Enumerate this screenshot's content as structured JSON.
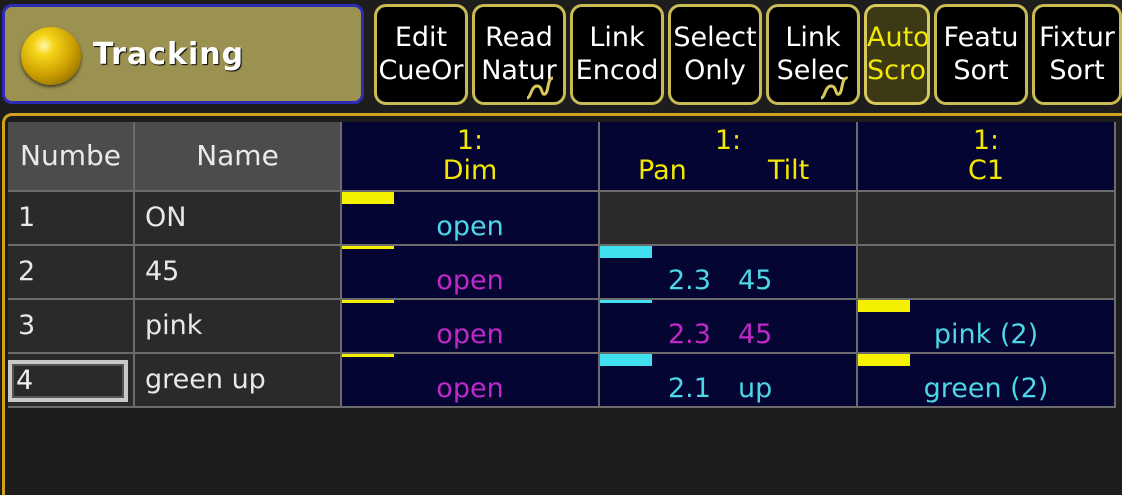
{
  "title": "Tracking",
  "toolbar": [
    {
      "l1": "Edit",
      "l2": "CueOr",
      "active": false,
      "curl": false
    },
    {
      "l1": "Read",
      "l2": "Natur",
      "active": false,
      "curl": true
    },
    {
      "l1": "Link",
      "l2": "Encod",
      "active": false,
      "curl": false
    },
    {
      "l1": "Select",
      "l2": "Only",
      "active": false,
      "curl": false
    },
    {
      "l1": "Link",
      "l2": "Selec",
      "active": false,
      "curl": true
    },
    {
      "l1": "Auto",
      "l2": "Scrol",
      "active": true,
      "curl": false
    },
    {
      "l1": "Featu",
      "l2": "Sort",
      "active": false,
      "curl": false
    },
    {
      "l1": "Fixtur",
      "l2": "Sort",
      "active": false,
      "curl": false
    }
  ],
  "table": {
    "headers": {
      "number": "Numbe",
      "name": "Name"
    },
    "columns": {
      "dim": {
        "fixture": "1:",
        "attr": "Dim"
      },
      "pt": {
        "fixture": "1:",
        "attr1": "Pan",
        "attr2": "Tilt"
      },
      "c1": {
        "fixture": "1:",
        "attr": "C1"
      }
    },
    "rows": [
      {
        "number": "1",
        "name": "ON",
        "dim": "open",
        "pt": null,
        "c1": null
      },
      {
        "number": "2",
        "name": "45",
        "dim": "open",
        "pt": {
          "pan": "2.3",
          "tilt": "45"
        },
        "c1": null
      },
      {
        "number": "3",
        "name": "pink",
        "dim": "open",
        "pt": {
          "pan": "2.3",
          "tilt": "45"
        },
        "c1": "pink (2)"
      },
      {
        "number": "4",
        "name": "green up",
        "dim": "open",
        "pt": {
          "pan": "2.1",
          "tilt": "up"
        },
        "c1": "green (2)"
      }
    ]
  },
  "colors": {
    "active_value": "#4dd7e6",
    "tracked_value": "#c128c8",
    "dim_bar_active": "#f5f000",
    "pt_bar_active": "#40e0f0",
    "c1_bar_active": "#f5f000"
  }
}
